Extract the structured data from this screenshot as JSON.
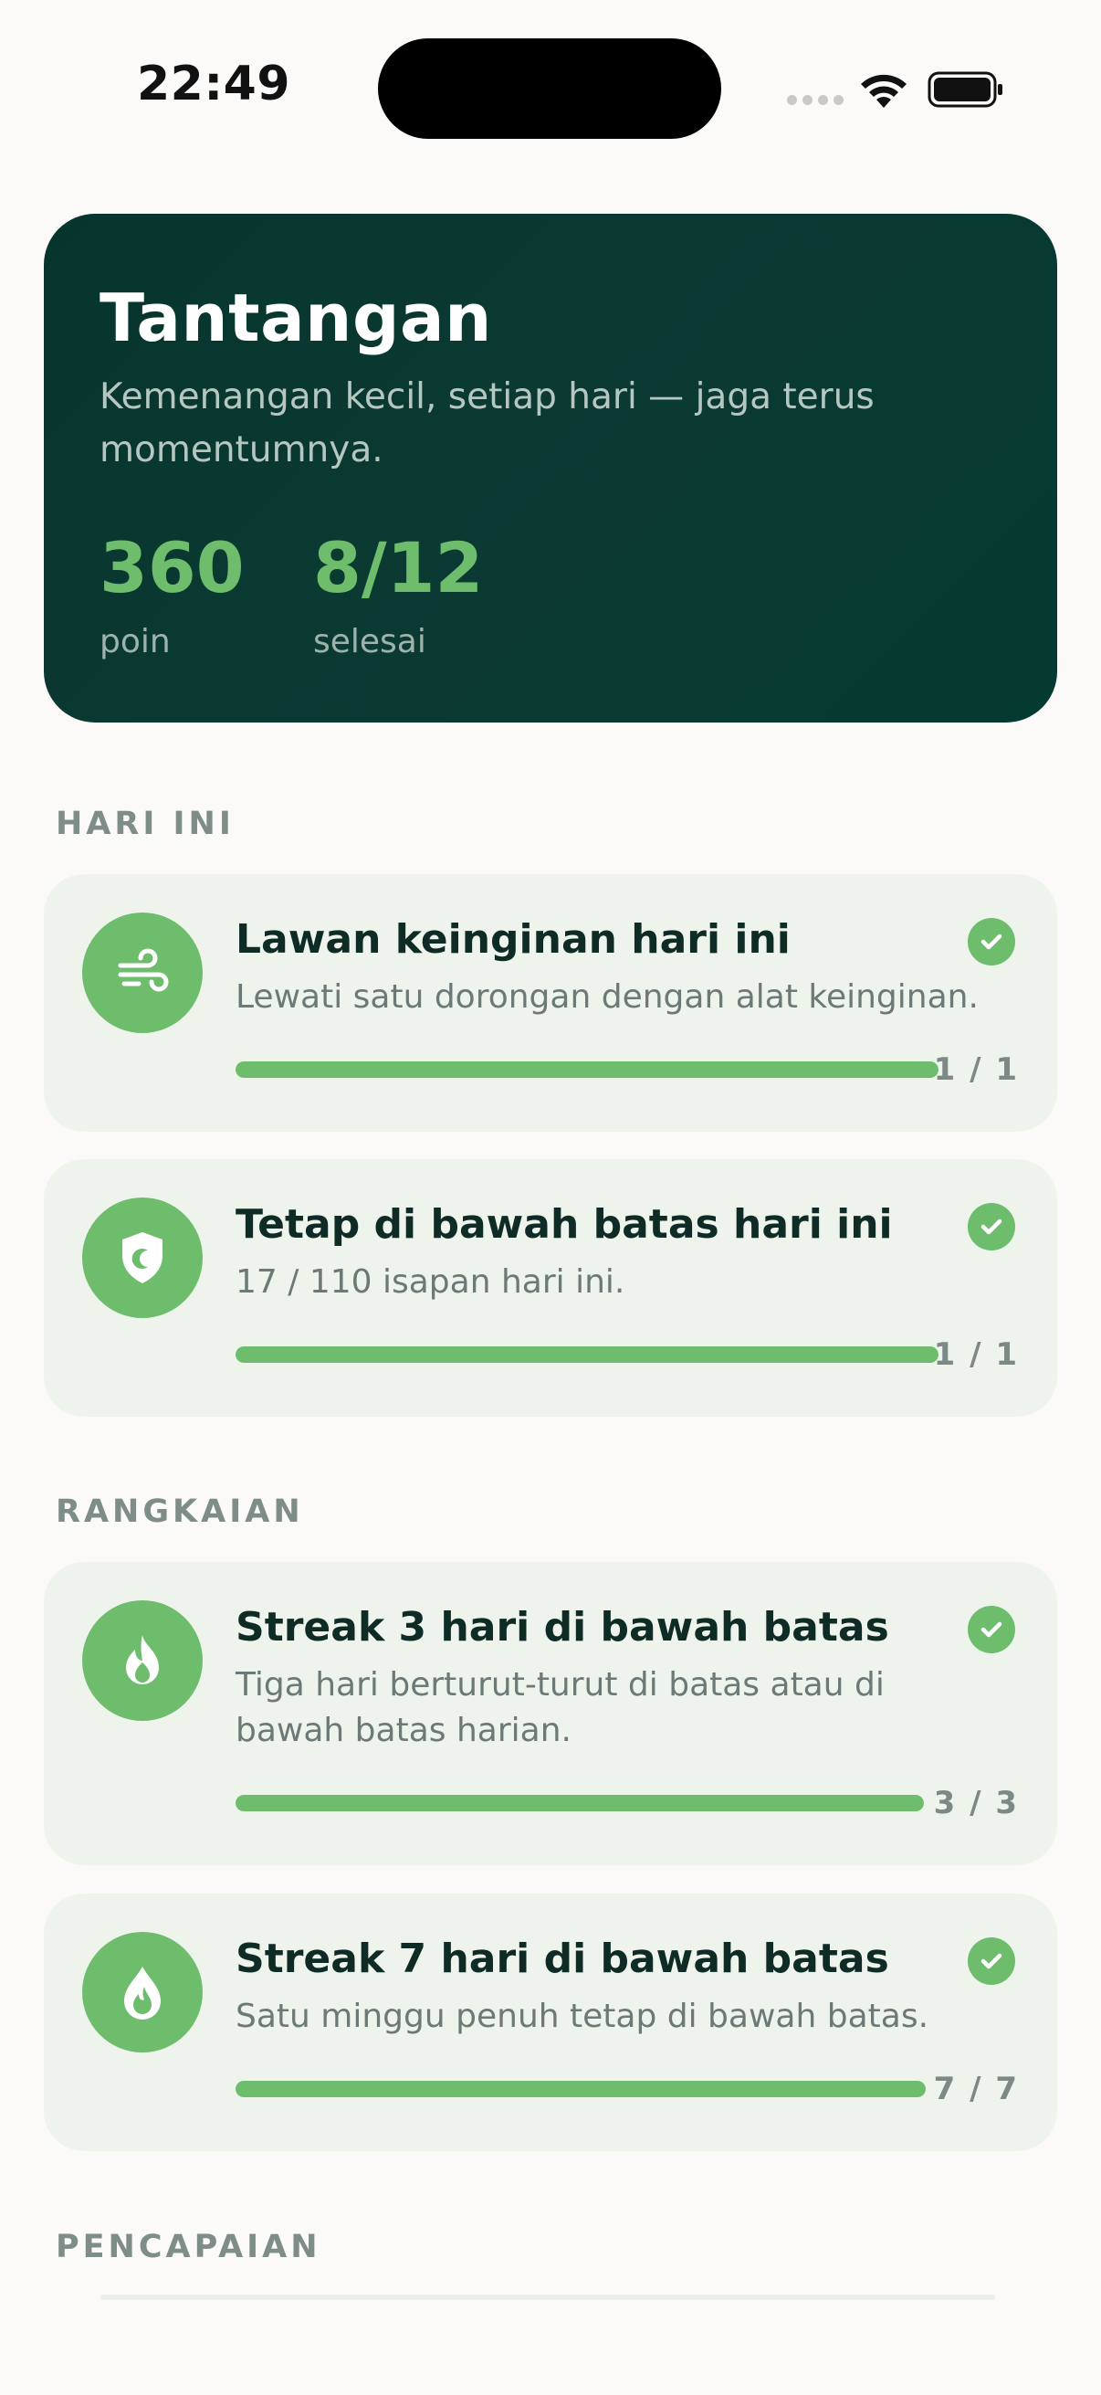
{
  "status_bar": {
    "time": "22:49"
  },
  "hero": {
    "title": "Tantangan",
    "subtitle": "Kemenangan kecil, setiap hari — jaga terus momentumnya.",
    "stats": [
      {
        "value": "360",
        "label": "poin"
      },
      {
        "value": "8/12",
        "label": "selesai"
      }
    ]
  },
  "sections": {
    "today": "HARI INI",
    "series": "RANGKAIAN",
    "achievements": "PENCAPAIAN"
  },
  "challenges": [
    {
      "title": "Lawan keinginan hari ini",
      "description": "Lewati satu dorongan dengan alat keinginan.",
      "progress_text": "1 / 1",
      "progress": 1.0,
      "completed": true,
      "icon": "wind-icon"
    },
    {
      "title": "Tetap di bawah batas hari ini",
      "description": "17 / 110 isapan hari ini.",
      "progress_text": "1 / 1",
      "progress": 1.0,
      "completed": true,
      "icon": "shield-icon"
    },
    {
      "title": "Streak 3 hari di bawah batas",
      "description": "Tiga hari berturut-turut di batas atau di bawah batas harian.",
      "progress_text": "3 / 3",
      "progress": 1.0,
      "completed": true,
      "icon": "flame-icon"
    },
    {
      "title": "Streak 7 hari di bawah batas",
      "description": "Satu minggu penuh tetap di bawah batas.",
      "progress_text": "7 / 7",
      "progress": 1.0,
      "completed": true,
      "icon": "drop-flame-icon"
    }
  ],
  "colors": {
    "accent": "#6dbd6c",
    "hero_bg": "#06352d",
    "card_bg": "#eef4ec",
    "page_bg": "#fbfaf8"
  }
}
